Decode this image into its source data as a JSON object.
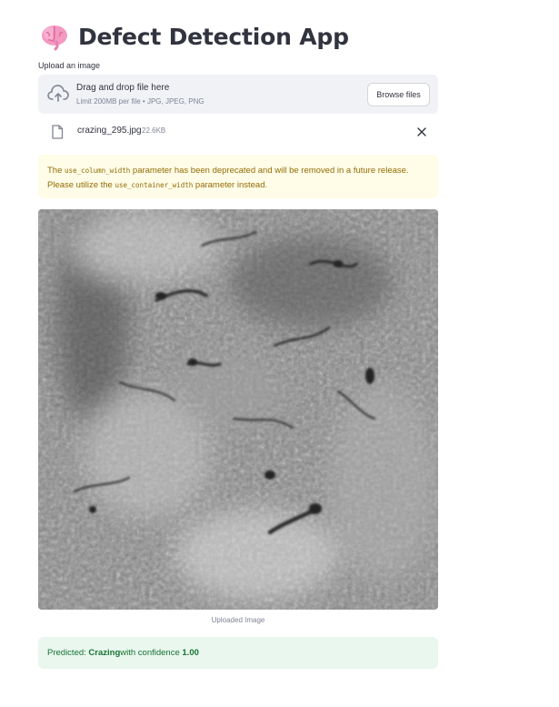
{
  "app": {
    "title": "Defect Detection App",
    "title_emoji": "brain-emoji"
  },
  "uploader": {
    "label": "Upload an image",
    "drop_text": "Drag and drop file here",
    "limit_text": "Limit 200MB per file • JPG, JPEG, PNG",
    "browse_label": "Browse files",
    "icon": "cloud-upload-icon"
  },
  "file": {
    "name": "crazing_295.jpg",
    "size": "22.6KB",
    "icon": "file-icon",
    "remove_icon": "close-icon"
  },
  "warning": {
    "part1": "The ",
    "code1": "use_column_width",
    "part2": " parameter has been deprecated and will be removed in a future release. Please utilize the ",
    "code2": "use_container_width",
    "part3": " parameter instead."
  },
  "image": {
    "caption": "Uploaded Image"
  },
  "result": {
    "prefix": "Predicted: ",
    "label": "Crazing",
    "middle": " with confidence ",
    "confidence": "1.00"
  },
  "colors": {
    "text": "#31333f",
    "muted": "#808495",
    "dropzone_bg": "#f0f2f6",
    "warning_bg": "#fffce7",
    "warning_text": "#926c05",
    "success_bg": "#e9f7ee",
    "success_text": "#177233"
  }
}
